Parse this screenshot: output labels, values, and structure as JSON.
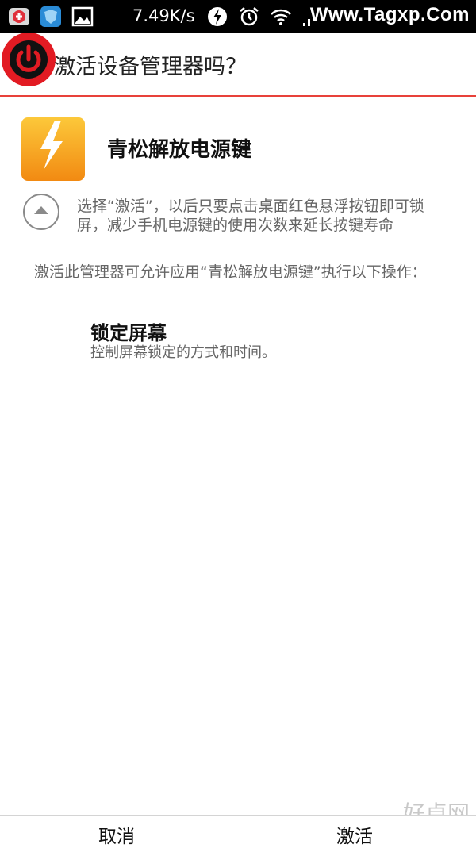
{
  "status_bar": {
    "network_speed": "7.49K/s",
    "watermark": "Www.Tagxp.Com",
    "icons": [
      "app-notification-icon",
      "shield-app-icon",
      "image-icon",
      "speed-boost-icon",
      "alarm-icon",
      "wifi-icon",
      "signal-icon"
    ]
  },
  "header": {
    "title": "激活设备管理器吗？"
  },
  "app": {
    "name": "青松解放电源键",
    "description": "选择“激活”，以后只要点击桌面红色悬浮按钮即可锁屏，减少手机电源键的使用次数来延长按键寿命"
  },
  "permissions": {
    "intro": "激活此管理器可允许应用“青松解放电源键”执行以下操作：",
    "items": [
      {
        "title": "锁定屏幕",
        "description": "控制屏幕锁定的方式和时间。"
      }
    ]
  },
  "buttons": {
    "cancel": "取消",
    "activate": "激活"
  },
  "site_mark": "好卓网",
  "colors": {
    "accent": "#e8413a",
    "app_icon": "#f7a81b",
    "power_button": "#e21b23"
  }
}
